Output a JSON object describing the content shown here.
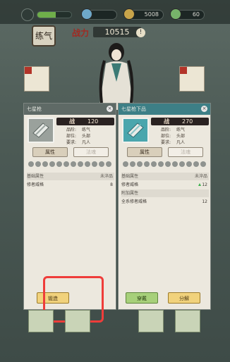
{
  "topbar": {
    "resources": [
      {
        "label": "",
        "value": ""
      },
      {
        "label": "",
        "value": "5008"
      },
      {
        "label": "",
        "value": "60"
      }
    ]
  },
  "power": {
    "label": "战力",
    "value": "10515"
  },
  "title_badge": "练气",
  "left_panel": {
    "header": "七星枪",
    "power_label": "战",
    "power_value": "120",
    "stats": [
      {
        "key": "品阶:",
        "value": "练气"
      },
      {
        "key": "部位:",
        "value": "头部"
      },
      {
        "key": "要求:",
        "value": "凡人"
      }
    ],
    "tabs": [
      "属性",
      "法魂"
    ],
    "rows": [
      {
        "label": "基础属性",
        "value": "未淬品",
        "section": true
      },
      {
        "label": "修者威格",
        "value": "8",
        "section": false
      }
    ],
    "button": "锻造"
  },
  "right_panel": {
    "header": "七星枪下品",
    "power_label": "战",
    "power_value": "270",
    "stats": [
      {
        "key": "品阶:",
        "value": "练气"
      },
      {
        "key": "部位:",
        "value": "头部"
      },
      {
        "key": "要求:",
        "value": "凡人"
      }
    ],
    "tabs": [
      "属性",
      "法魂"
    ],
    "rows": [
      {
        "label": "基础属性",
        "value": "未淬品",
        "section": true
      },
      {
        "label": "修者威格",
        "value": "12",
        "section": false,
        "increase": true
      },
      {
        "label": "附加属性",
        "value": "",
        "section": true
      },
      {
        "label": "全系修者威格",
        "value": "12",
        "section": false
      }
    ],
    "buttons": [
      "穿戴",
      "分解"
    ]
  },
  "colors": {
    "highlight_box": "#ef3d3a",
    "power_red": "#a12a22"
  }
}
